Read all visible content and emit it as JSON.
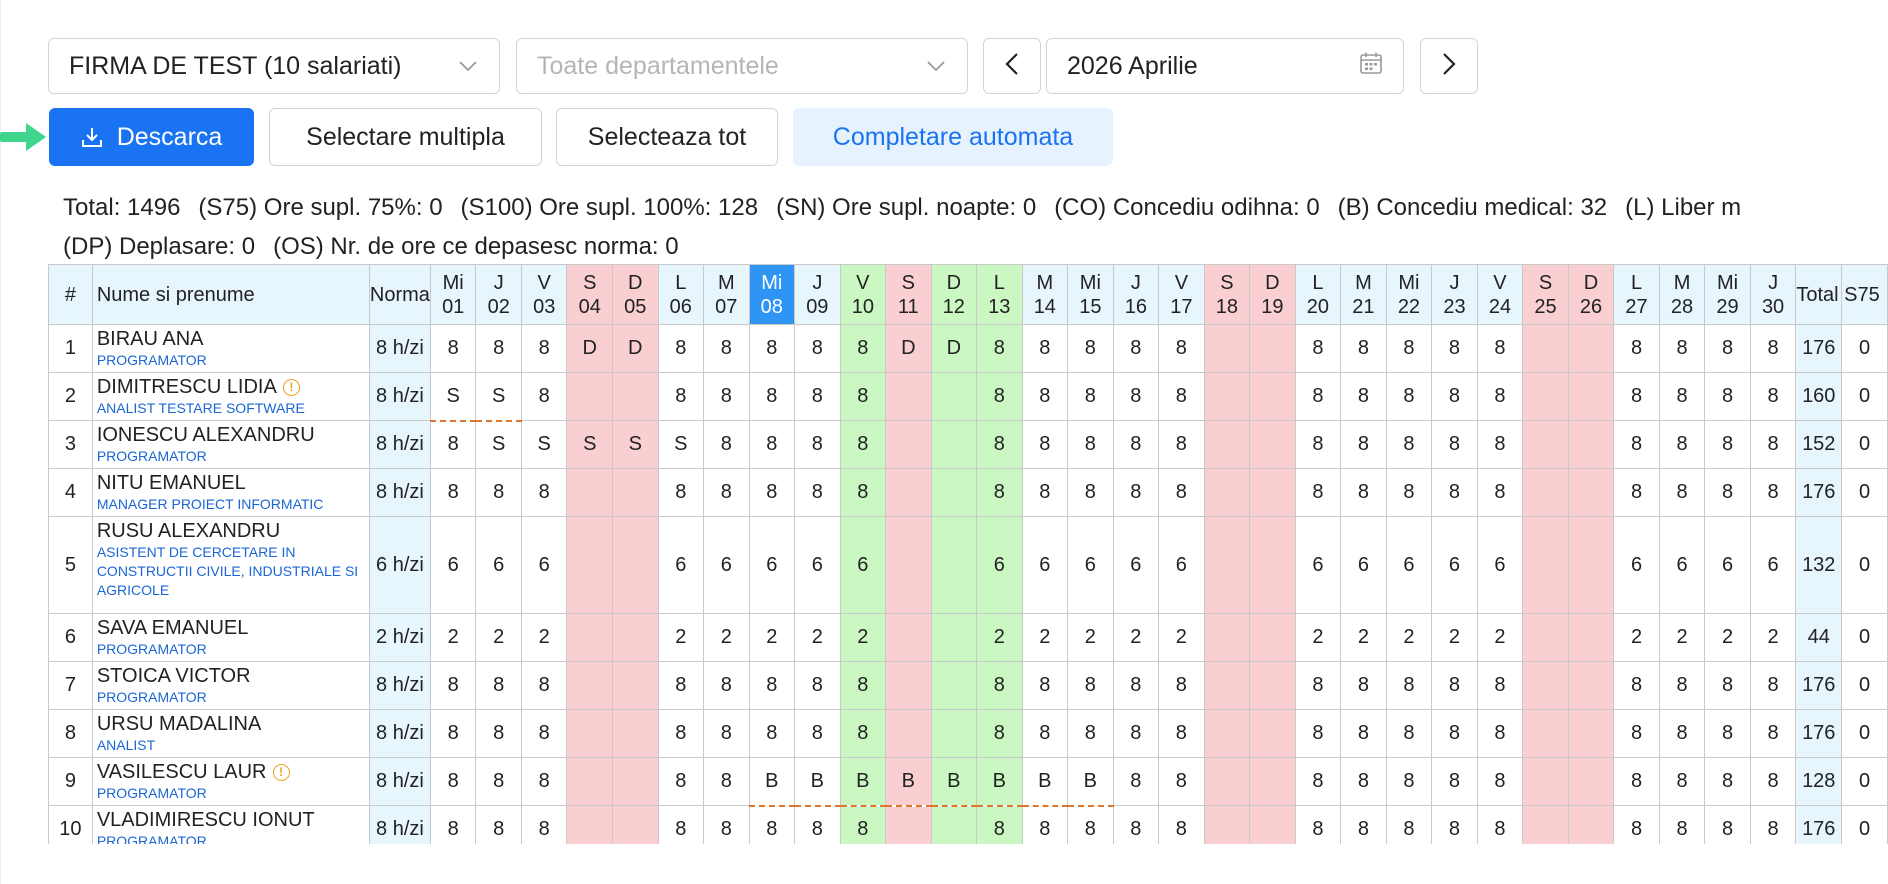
{
  "filters": {
    "company": "FIRMA DE TEST (10 salariati)",
    "department_placeholder": "Toate departamentele",
    "period": "2026 Aprilie"
  },
  "icons": {
    "chevron": "chevron-down-icon",
    "prev": "chevron-left-icon",
    "next": "chevron-right-icon",
    "calendar": "calendar-icon",
    "download": "download-icon",
    "warning": "warning-icon",
    "pointer": "green-arrow-icon"
  },
  "colors": {
    "primary": "#1a73f2",
    "weekend": "#f9cfd1",
    "holiday": "#cbf7c2",
    "today": "#2f95f5",
    "norm": "#e7f6fd",
    "warning": "#f0a020",
    "pointer_arrow": "#3dd68c"
  },
  "actions": {
    "download": "Descarca",
    "multi_select": "Selectare multipla",
    "select_all": "Selecteaza tot",
    "auto_fill": "Completare automata"
  },
  "summary": {
    "line1": [
      "Total: 1496",
      "(S75) Ore supl. 75%: 0",
      "(S100) Ore supl. 100%: 128",
      "(SN) Ore supl. noapte: 0",
      "(CO) Concediu odihna: 0",
      "(B) Concediu medical: 32",
      "(L) Liber m"
    ],
    "line2": [
      "(DP) Deplasare: 0",
      "(OS) Nr. de ore ce depasesc norma: 0"
    ]
  },
  "table": {
    "headers": {
      "index": "#",
      "name": "Nume si prenume",
      "norm": "Norma",
      "total": "Total",
      "s75": "S75"
    },
    "days": [
      {
        "d": "Mi",
        "n": "01",
        "t": ""
      },
      {
        "d": "J",
        "n": "02",
        "t": ""
      },
      {
        "d": "V",
        "n": "03",
        "t": ""
      },
      {
        "d": "S",
        "n": "04",
        "t": "wk"
      },
      {
        "d": "D",
        "n": "05",
        "t": "wk"
      },
      {
        "d": "L",
        "n": "06",
        "t": ""
      },
      {
        "d": "M",
        "n": "07",
        "t": ""
      },
      {
        "d": "Mi",
        "n": "08",
        "t": "today"
      },
      {
        "d": "J",
        "n": "09",
        "t": ""
      },
      {
        "d": "V",
        "n": "10",
        "t": "hol"
      },
      {
        "d": "S",
        "n": "11",
        "t": "wk"
      },
      {
        "d": "D",
        "n": "12",
        "t": "hol"
      },
      {
        "d": "L",
        "n": "13",
        "t": "hol"
      },
      {
        "d": "M",
        "n": "14",
        "t": ""
      },
      {
        "d": "Mi",
        "n": "15",
        "t": ""
      },
      {
        "d": "J",
        "n": "16",
        "t": ""
      },
      {
        "d": "V",
        "n": "17",
        "t": ""
      },
      {
        "d": "S",
        "n": "18",
        "t": "wk"
      },
      {
        "d": "D",
        "n": "19",
        "t": "wk"
      },
      {
        "d": "L",
        "n": "20",
        "t": ""
      },
      {
        "d": "M",
        "n": "21",
        "t": ""
      },
      {
        "d": "Mi",
        "n": "22",
        "t": ""
      },
      {
        "d": "J",
        "n": "23",
        "t": ""
      },
      {
        "d": "V",
        "n": "24",
        "t": ""
      },
      {
        "d": "S",
        "n": "25",
        "t": "wk"
      },
      {
        "d": "D",
        "n": "26",
        "t": "wk"
      },
      {
        "d": "L",
        "n": "27",
        "t": ""
      },
      {
        "d": "M",
        "n": "28",
        "t": ""
      },
      {
        "d": "Mi",
        "n": "29",
        "t": ""
      },
      {
        "d": "J",
        "n": "30",
        "t": ""
      }
    ],
    "rows": [
      {
        "idx": "1",
        "name": "BIRAU ANA",
        "role": "PROGRAMATOR",
        "norm": "8 h/zi",
        "warn": false,
        "cells": [
          "8",
          "8",
          "8",
          "D",
          "D",
          "8",
          "8",
          "8",
          "8",
          "8",
          "D",
          "D",
          "8",
          "8",
          "8",
          "8",
          "8",
          "",
          "",
          "8",
          "8",
          "8",
          "8",
          "8",
          "",
          "",
          "8",
          "8",
          "8",
          "8"
        ],
        "total": "176",
        "s75": "0",
        "dashed": []
      },
      {
        "idx": "2",
        "name": "DIMITRESCU LIDIA",
        "role": "ANALIST TESTARE SOFTWARE",
        "norm": "8 h/zi",
        "warn": true,
        "cells": [
          "S",
          "S",
          "8",
          "",
          "",
          "8",
          "8",
          "8",
          "8",
          "8",
          "",
          "",
          "8",
          "8",
          "8",
          "8",
          "8",
          "",
          "",
          "8",
          "8",
          "8",
          "8",
          "8",
          "",
          "",
          "8",
          "8",
          "8",
          "8"
        ],
        "total": "160",
        "s75": "0",
        "dashed": [
          0,
          1
        ]
      },
      {
        "idx": "3",
        "name": "IONESCU ALEXANDRU",
        "role": "PROGRAMATOR",
        "norm": "8 h/zi",
        "warn": false,
        "cells": [
          "8",
          "S",
          "S",
          "S",
          "S",
          "S",
          "8",
          "8",
          "8",
          "8",
          "",
          "",
          "8",
          "8",
          "8",
          "8",
          "8",
          "",
          "",
          "8",
          "8",
          "8",
          "8",
          "8",
          "",
          "",
          "8",
          "8",
          "8",
          "8"
        ],
        "total": "152",
        "s75": "0",
        "dashed": []
      },
      {
        "idx": "4",
        "name": "NITU EMANUEL",
        "role": "MANAGER PROIECT INFORMATIC",
        "norm": "8 h/zi",
        "warn": false,
        "cells": [
          "8",
          "8",
          "8",
          "",
          "",
          "8",
          "8",
          "8",
          "8",
          "8",
          "",
          "",
          "8",
          "8",
          "8",
          "8",
          "8",
          "",
          "",
          "8",
          "8",
          "8",
          "8",
          "8",
          "",
          "",
          "8",
          "8",
          "8",
          "8"
        ],
        "total": "176",
        "s75": "0",
        "dashed": []
      },
      {
        "idx": "5",
        "name": "RUSU ALEXANDRU",
        "role": "ASISTENT DE CERCETARE IN CONSTRUCTII CIVILE, INDUSTRIALE SI AGRICOLE",
        "norm": "6 h/zi",
        "warn": false,
        "tall": true,
        "cells": [
          "6",
          "6",
          "6",
          "",
          "",
          "6",
          "6",
          "6",
          "6",
          "6",
          "",
          "",
          "6",
          "6",
          "6",
          "6",
          "6",
          "",
          "",
          "6",
          "6",
          "6",
          "6",
          "6",
          "",
          "",
          "6",
          "6",
          "6",
          "6"
        ],
        "total": "132",
        "s75": "0",
        "dashed": []
      },
      {
        "idx": "6",
        "name": "SAVA EMANUEL",
        "role": "PROGRAMATOR",
        "norm": "2 h/zi",
        "warn": false,
        "cells": [
          "2",
          "2",
          "2",
          "",
          "",
          "2",
          "2",
          "2",
          "2",
          "2",
          "",
          "",
          "2",
          "2",
          "2",
          "2",
          "2",
          "",
          "",
          "2",
          "2",
          "2",
          "2",
          "2",
          "",
          "",
          "2",
          "2",
          "2",
          "2"
        ],
        "total": "44",
        "s75": "0",
        "dashed": []
      },
      {
        "idx": "7",
        "name": "STOICA VICTOR",
        "role": "PROGRAMATOR",
        "norm": "8 h/zi",
        "warn": false,
        "cells": [
          "8",
          "8",
          "8",
          "",
          "",
          "8",
          "8",
          "8",
          "8",
          "8",
          "",
          "",
          "8",
          "8",
          "8",
          "8",
          "8",
          "",
          "",
          "8",
          "8",
          "8",
          "8",
          "8",
          "",
          "",
          "8",
          "8",
          "8",
          "8"
        ],
        "total": "176",
        "s75": "0",
        "dashed": []
      },
      {
        "idx": "8",
        "name": "URSU MADALINA",
        "role": "ANALIST",
        "norm": "8 h/zi",
        "warn": false,
        "cells": [
          "8",
          "8",
          "8",
          "",
          "",
          "8",
          "8",
          "8",
          "8",
          "8",
          "",
          "",
          "8",
          "8",
          "8",
          "8",
          "8",
          "",
          "",
          "8",
          "8",
          "8",
          "8",
          "8",
          "",
          "",
          "8",
          "8",
          "8",
          "8"
        ],
        "total": "176",
        "s75": "0",
        "dashed": []
      },
      {
        "idx": "9",
        "name": "VASILESCU LAUR",
        "role": "PROGRAMATOR",
        "norm": "8 h/zi",
        "warn": true,
        "cells": [
          "8",
          "8",
          "8",
          "",
          "",
          "8",
          "8",
          "B",
          "B",
          "B",
          "B",
          "B",
          "B",
          "B",
          "B",
          "8",
          "8",
          "",
          "",
          "8",
          "8",
          "8",
          "8",
          "8",
          "",
          "",
          "8",
          "8",
          "8",
          "8"
        ],
        "total": "128",
        "s75": "0",
        "dashed": [
          7,
          8,
          9,
          10,
          11,
          12,
          13,
          14
        ]
      },
      {
        "idx": "10",
        "name": "VLADIMIRESCU IONUT",
        "role": "PROGRAMATOR",
        "norm": "8 h/zi",
        "warn": false,
        "cells": [
          "8",
          "8",
          "8",
          "",
          "",
          "8",
          "8",
          "8",
          "8",
          "8",
          "",
          "",
          "8",
          "8",
          "8",
          "8",
          "8",
          "",
          "",
          "8",
          "8",
          "8",
          "8",
          "8",
          "",
          "",
          "8",
          "8",
          "8",
          "8"
        ],
        "total": "176",
        "s75": "0",
        "dashed": []
      }
    ]
  }
}
